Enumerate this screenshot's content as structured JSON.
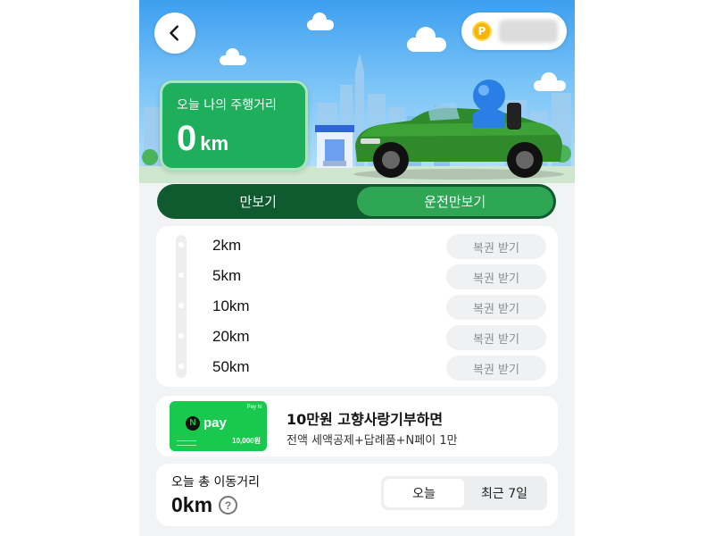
{
  "header": {
    "coin_symbol": "P",
    "distance_label": "오늘 나의 주행거리",
    "distance_value": "0",
    "distance_unit": "km"
  },
  "tabs": [
    {
      "label": "만보기",
      "active": false
    },
    {
      "label": "운전만보기",
      "active": true
    }
  ],
  "milestones": [
    {
      "distance": "2km",
      "button": "복권 받기"
    },
    {
      "distance": "5km",
      "button": "복권 받기"
    },
    {
      "distance": "10km",
      "button": "복권 받기"
    },
    {
      "distance": "20km",
      "button": "복권 받기"
    },
    {
      "distance": "50km",
      "button": "복권 받기"
    }
  ],
  "promo": {
    "card_brand": "pay",
    "card_brand_icon": "N",
    "card_corner": "Pay N",
    "card_amount": "10,000원",
    "title": "10만원 고향사랑기부하면",
    "subtitle": "전액 세액공제+답례품+N페이 1만"
  },
  "total": {
    "label": "오늘 총 이동거리",
    "value": "0km",
    "help_symbol": "?",
    "segments": [
      {
        "label": "오늘",
        "active": true
      },
      {
        "label": "최근 7일",
        "active": false
      }
    ]
  },
  "colors": {
    "brand_green": "#1fae5c",
    "tab_dark": "#0f5a2e",
    "tab_active": "#2fa653",
    "npay_green": "#19c94e"
  }
}
